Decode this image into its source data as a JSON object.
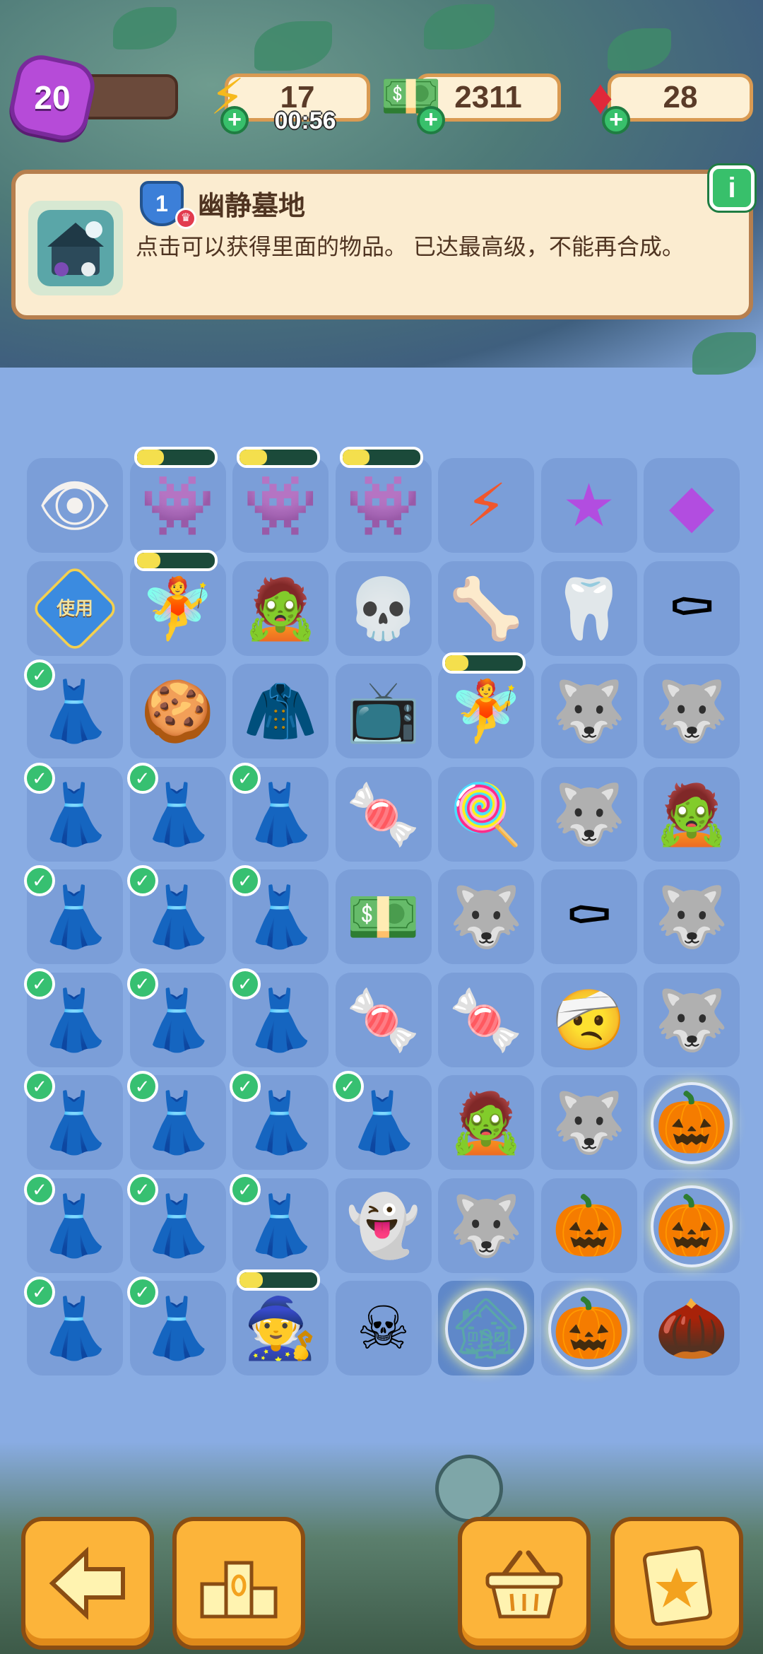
{
  "hud": {
    "level": "20",
    "energy": "17",
    "timer": "00:56",
    "cash": "2311",
    "gems": "28"
  },
  "info": {
    "rank": "1",
    "title": "幽静墓地",
    "description": "点击可以获得里面的物品。 已达最高级，不能再合成。",
    "info_button": "i"
  },
  "board": {
    "use_label": "使用",
    "cells": [
      [
        {
          "icon": "eyeball-icon",
          "glyph": "👁",
          "check": false,
          "bar": null
        },
        {
          "icon": "monster-chest-icon",
          "glyph": "👾",
          "check": false,
          "bar": 0.35
        },
        {
          "icon": "monster-chest-icon",
          "glyph": "👾",
          "check": false,
          "bar": 0.35
        },
        {
          "icon": "monster-chest-icon",
          "glyph": "👾",
          "check": false,
          "bar": 0.35
        },
        {
          "icon": "energy-orb-icon",
          "glyph": "⚡",
          "check": false,
          "bar": null
        },
        {
          "icon": "purple-star-icon",
          "glyph": "★",
          "check": false,
          "bar": null
        },
        {
          "icon": "purple-gem-icon",
          "glyph": "◆",
          "check": false,
          "bar": null
        }
      ],
      [
        {
          "icon": "use-card-icon",
          "glyph": "",
          "check": false,
          "bar": null,
          "use": true
        },
        {
          "icon": "fairy-girl-icon",
          "glyph": "🧚",
          "check": false,
          "bar": 0.3
        },
        {
          "icon": "hooded-mummy-icon",
          "glyph": "🧟",
          "check": false,
          "bar": null
        },
        {
          "icon": "skull-lollipop-icon",
          "glyph": "💀",
          "check": false,
          "bar": null
        },
        {
          "icon": "skeleton-pajamas-icon",
          "glyph": "🦴",
          "check": false,
          "bar": null
        },
        {
          "icon": "tooth-icon",
          "glyph": "🦷",
          "check": false,
          "bar": null
        },
        {
          "icon": "bat-coffin-icon",
          "glyph": "⚰",
          "check": false,
          "bar": null
        }
      ],
      [
        {
          "icon": "pumpkin-skirt-icon",
          "glyph": "👗",
          "check": true,
          "bar": null
        },
        {
          "icon": "jack-o-lantern-cookie-icon",
          "glyph": "🍪",
          "check": false,
          "bar": null
        },
        {
          "icon": "witch-cloak-icon",
          "glyph": "🧥",
          "check": false,
          "bar": null
        },
        {
          "icon": "rainbow-tv-icon",
          "glyph": "📺",
          "check": false,
          "bar": null
        },
        {
          "icon": "fairy-girl-icon",
          "glyph": "🧚",
          "check": false,
          "bar": 0.3
        },
        {
          "icon": "werewolf-head-icon",
          "glyph": "🐺",
          "check": false,
          "bar": null
        },
        {
          "icon": "werewolf-head-icon",
          "glyph": "🐺",
          "check": false,
          "bar": null
        }
      ],
      [
        {
          "icon": "pumpkin-skirt-icon",
          "glyph": "👗",
          "check": true,
          "bar": null
        },
        {
          "icon": "pumpkin-skirt-icon",
          "glyph": "👗",
          "check": true,
          "bar": null
        },
        {
          "icon": "pumpkin-skirt-icon",
          "glyph": "👗",
          "check": true,
          "bar": null
        },
        {
          "icon": "candy-bowl-icon",
          "glyph": "🍬",
          "check": false,
          "bar": null
        },
        {
          "icon": "treat-bowl-icon",
          "glyph": "🍭",
          "check": false,
          "bar": null
        },
        {
          "icon": "werewolf-head-icon",
          "glyph": "🐺",
          "check": false,
          "bar": null
        },
        {
          "icon": "zombie-head-icon",
          "glyph": "🧟",
          "check": false,
          "bar": null
        }
      ],
      [
        {
          "icon": "pumpkin-skirt-icon",
          "glyph": "👗",
          "check": true,
          "bar": null
        },
        {
          "icon": "pumpkin-skirt-icon",
          "glyph": "👗",
          "check": true,
          "bar": null
        },
        {
          "icon": "pumpkin-skirt-icon",
          "glyph": "👗",
          "check": true,
          "bar": null
        },
        {
          "icon": "cash-stack-icon",
          "glyph": "💵",
          "check": false,
          "bar": null
        },
        {
          "icon": "werewolf-head-icon",
          "glyph": "🐺",
          "check": false,
          "bar": null
        },
        {
          "icon": "purple-coffin-icon",
          "glyph": "⚰",
          "check": false,
          "bar": null
        },
        {
          "icon": "werewolf-head-icon",
          "glyph": "🐺",
          "check": false,
          "bar": null
        }
      ],
      [
        {
          "icon": "pumpkin-skirt-icon",
          "glyph": "👗",
          "check": true,
          "bar": null
        },
        {
          "icon": "pumpkin-skirt-icon",
          "glyph": "👗",
          "check": true,
          "bar": null
        },
        {
          "icon": "pumpkin-skirt-icon",
          "glyph": "👗",
          "check": true,
          "bar": null
        },
        {
          "icon": "candy-bowl-icon",
          "glyph": "🍬",
          "check": false,
          "bar": null
        },
        {
          "icon": "wrapped-candy-icon",
          "glyph": "🍬",
          "check": false,
          "bar": null
        },
        {
          "icon": "mummy-head-icon",
          "glyph": "🤕",
          "check": false,
          "bar": null
        },
        {
          "icon": "werewolf-head-icon",
          "glyph": "🐺",
          "check": false,
          "bar": null
        }
      ],
      [
        {
          "icon": "pumpkin-skirt-icon",
          "glyph": "👗",
          "check": true,
          "bar": null
        },
        {
          "icon": "pumpkin-skirt-icon",
          "glyph": "👗",
          "check": true,
          "bar": null
        },
        {
          "icon": "pumpkin-skirt-icon",
          "glyph": "👗",
          "check": true,
          "bar": null
        },
        {
          "icon": "pumpkin-skirt-icon",
          "glyph": "👗",
          "check": true,
          "bar": null
        },
        {
          "icon": "zombie-head-icon",
          "glyph": "🧟",
          "check": false,
          "bar": null
        },
        {
          "icon": "werewolf-head-icon",
          "glyph": "🐺",
          "check": false,
          "bar": null
        },
        {
          "icon": "pumpkin-patch-bubble-icon",
          "glyph": "🎃",
          "check": false,
          "bar": null,
          "bubble": true
        }
      ],
      [
        {
          "icon": "pumpkin-skirt-icon",
          "glyph": "👗",
          "check": true,
          "bar": null
        },
        {
          "icon": "pumpkin-skirt-icon",
          "glyph": "👗",
          "check": true,
          "bar": null
        },
        {
          "icon": "pumpkin-skirt-icon",
          "glyph": "👗",
          "check": true,
          "bar": null
        },
        {
          "icon": "ghost-icon",
          "glyph": "👻",
          "check": false,
          "bar": null
        },
        {
          "icon": "werewolf-head-icon",
          "glyph": "🐺",
          "check": false,
          "bar": null
        },
        {
          "icon": "jack-o-lantern-icon",
          "glyph": "🎃",
          "check": false,
          "bar": null
        },
        {
          "icon": "pumpkin-patch-bubble-icon",
          "glyph": "🎃",
          "check": false,
          "bar": null,
          "bubble": true
        }
      ],
      [
        {
          "icon": "pumpkin-skirt-icon",
          "glyph": "👗",
          "check": true,
          "bar": null
        },
        {
          "icon": "pumpkin-skirt-icon",
          "glyph": "👗",
          "check": true,
          "bar": null
        },
        {
          "icon": "red-hood-girl-icon",
          "glyph": "🧙",
          "check": false,
          "bar": 0.3
        },
        {
          "icon": "hooded-skull-icon",
          "glyph": "☠",
          "check": false,
          "bar": null
        },
        {
          "icon": "haunted-graveyard-icon",
          "glyph": "🏚",
          "check": false,
          "bar": null,
          "bubble": true,
          "selected": true
        },
        {
          "icon": "crying-pumpkin-bubble-icon",
          "glyph": "🎃",
          "check": false,
          "bar": null,
          "bubble": true
        },
        {
          "icon": "seeds-icon",
          "glyph": "🌰",
          "check": false,
          "bar": null
        }
      ]
    ]
  },
  "buttons": {
    "back": "back-arrow-icon",
    "rank": "podium-icon",
    "shop": "basket-icon",
    "tasks": "clipboard-star-icon"
  },
  "colors": {
    "board_bg": "#89ace3",
    "cell_bg": "#7b9ed8",
    "panel_bg": "#fbecd0",
    "button_orange": "#fcb43a",
    "check_green": "#37c071"
  }
}
